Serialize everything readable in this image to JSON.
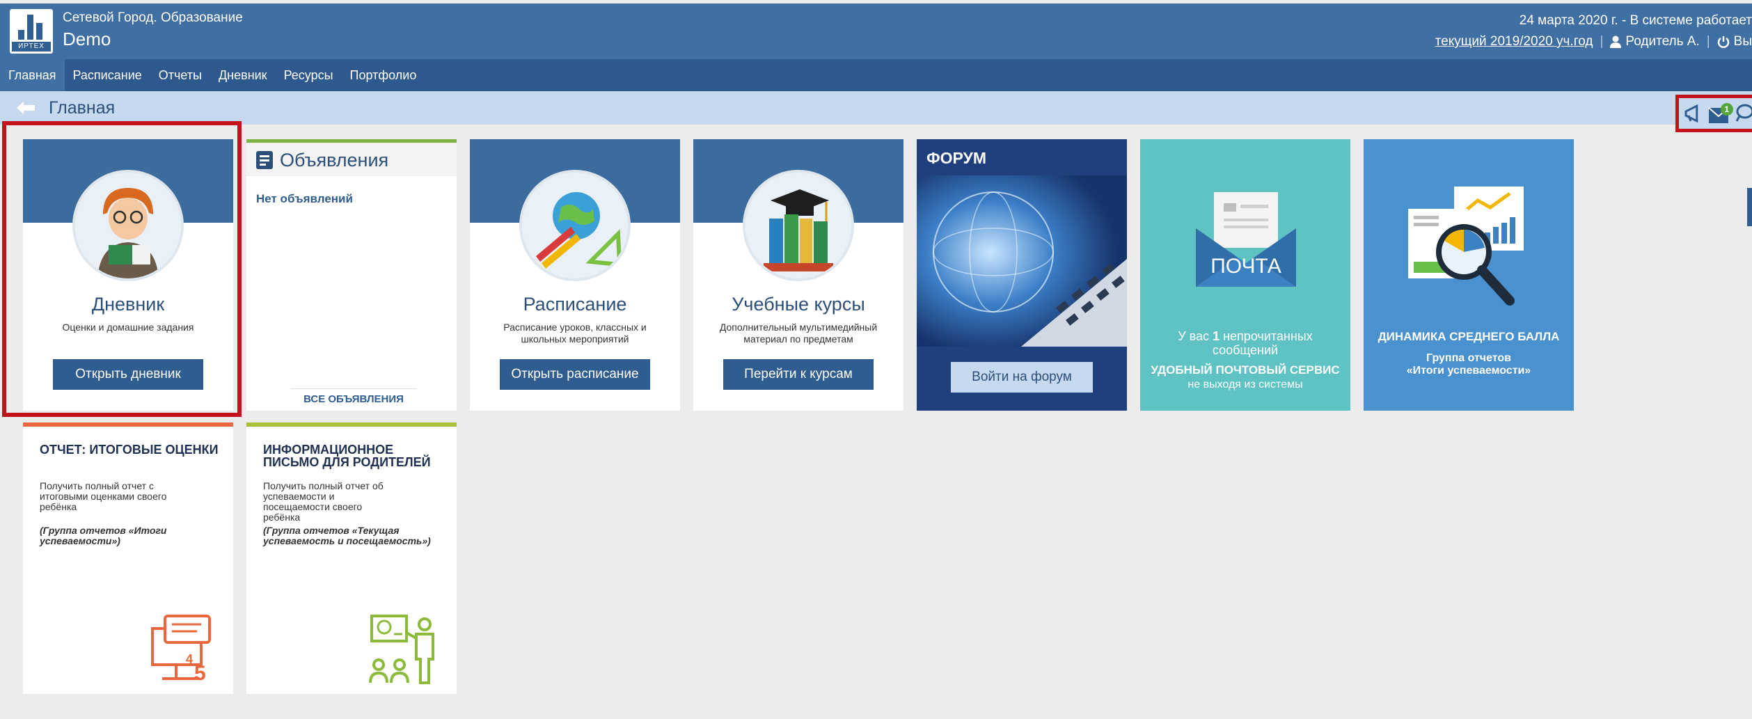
{
  "header": {
    "app_title": "Сетевой Город. Образование",
    "app_subtitle": "Demo",
    "brand": "ИРТЕХ",
    "status_line": "24 марта 2020 г. - В системе работает",
    "school_year": "текущий 2019/2020 уч.год",
    "user": "Родитель А.",
    "logout": "Вы"
  },
  "nav": {
    "items": [
      {
        "label": "Главная",
        "active": true
      },
      {
        "label": "Расписание"
      },
      {
        "label": "Отчеты"
      },
      {
        "label": "Дневник"
      },
      {
        "label": "Ресурсы"
      },
      {
        "label": "Портфолио"
      }
    ]
  },
  "breadcrumb": {
    "title": "Главная",
    "mail_badge": "1"
  },
  "tiles": {
    "diary": {
      "title": "Дневник",
      "desc": "Оценки и домашние задания",
      "button": "Открыть дневник"
    },
    "announcements": {
      "title": "Объявления",
      "empty": "Нет объявлений",
      "all": "ВСЕ ОБЪЯВЛЕНИЯ"
    },
    "schedule": {
      "title": "Расписание",
      "desc": "Расписание уроков, классных и школьных мероприятий",
      "button": "Открыть расписание"
    },
    "courses": {
      "title": "Учебные курсы",
      "desc": "Дополнительный мультимедийный материал по предметам",
      "button": "Перейти к курсам"
    },
    "forum": {
      "title": "ФОРУМ",
      "button": "Войти на форум"
    },
    "mail": {
      "envelope_label": "ПОЧТА",
      "line1_prefix": "У вас",
      "count": "1",
      "line1_suffix": "непрочитанных",
      "line2": "сообщений",
      "service": "УДОБНЫЙ ПОЧТОВЫЙ СЕРВИС",
      "service_sub": "не выходя из системы"
    },
    "dynamics": {
      "title": "ДИНАМИКА СРЕДНЕГО БАЛЛА",
      "group_line1": "Группа отчетов",
      "group_line2": "«Итоги успеваемости»"
    }
  },
  "reports": [
    {
      "title": "ОТЧЕТ: ИТОГОВЫЕ ОЦЕНКИ",
      "desc": "Получить полный отчет с итоговыми оценками своего ребёнка",
      "group": "(Группа отчетов «Итоги успеваемости»)",
      "color": "#e8673c"
    },
    {
      "title": "ИНФОРМАЦИОННОЕ ПИСЬМО ДЛЯ РОДИТЕЛЕЙ",
      "desc": "Получить полный отчет об успеваемости и посещаемости своего ребёнка",
      "group": "(Группа отчетов «Текущая успеваемость и посещаемость»)",
      "color": "#a8c23a"
    }
  ],
  "report_icon_digits": {
    "a": "4",
    "b": "5"
  },
  "colors": {
    "header": "#3f6fa3",
    "nav": "#2e598f",
    "crumb": "#c6d9ee",
    "highlight": "#c4121d"
  }
}
